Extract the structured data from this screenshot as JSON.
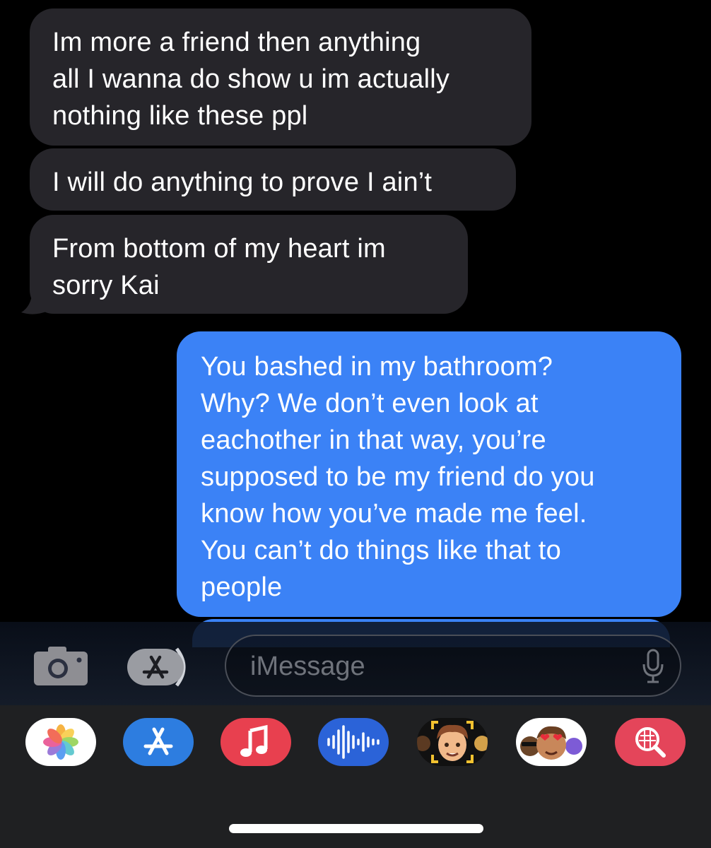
{
  "messages": {
    "received": [
      "Im more a friend then anything\nall I wanna do show u im actually\nnothing like these ppl",
      "I will do anything to prove I ain’t",
      "From bottom of my heart im\nsorry Kai"
    ],
    "sent": [
      "You bashed in my bathroom?\nWhy? We don’t even look at\neachother in that way, you’re\nsupposed to be my friend do you\nknow how you’ve made me feel.\nYou can’t do things like that to\npeople"
    ]
  },
  "compose": {
    "placeholder": "iMessage",
    "camera_icon": "camera-icon",
    "apps_icon": "app-store-icon",
    "mic_icon": "microphone-icon"
  },
  "app_tray": {
    "apps": [
      "photos-icon",
      "app-store-icon",
      "music-icon",
      "audio-message-icon",
      "memoji-icon",
      "memoji-stickers-icon",
      "image-search-icon"
    ]
  },
  "colors": {
    "received_bubble": "#26252a",
    "sent_bubble": "#3b82f6",
    "background": "#000000",
    "tray": "#1f2022"
  }
}
